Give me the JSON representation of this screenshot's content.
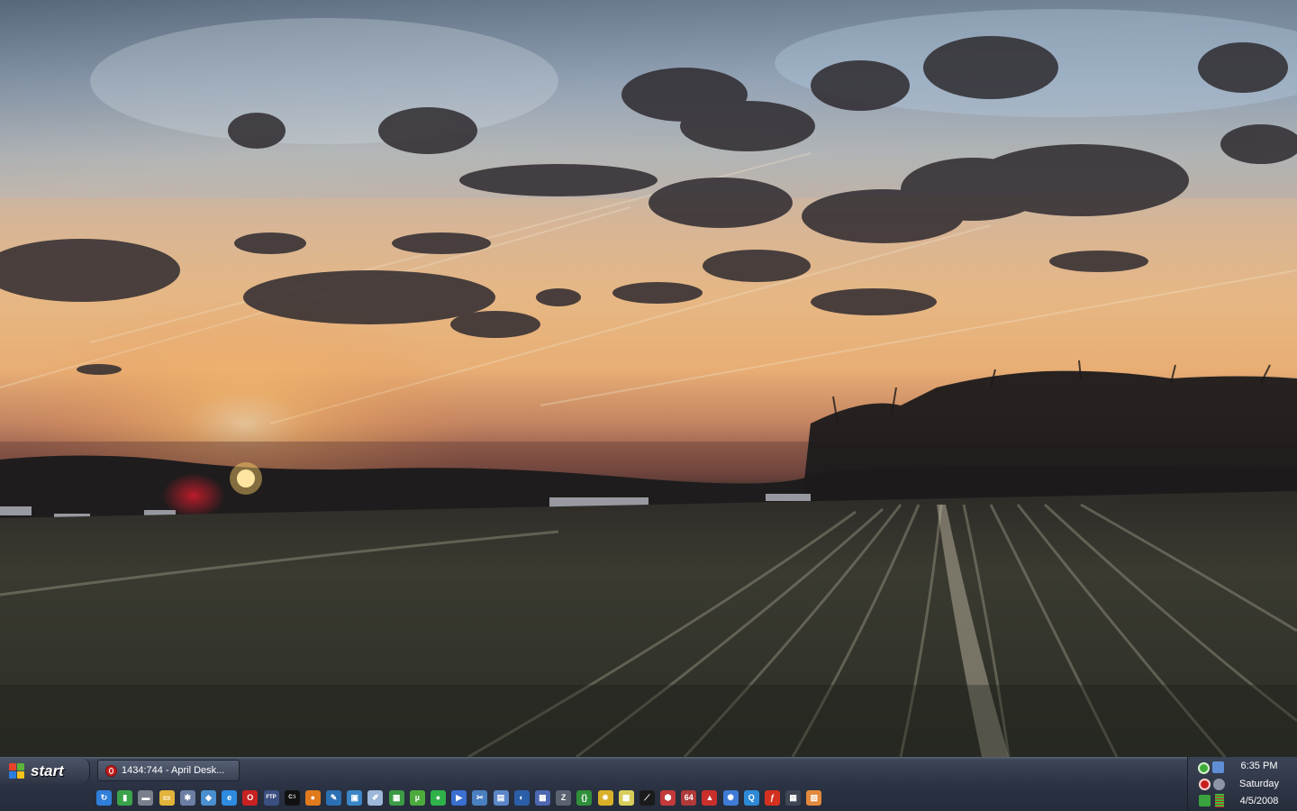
{
  "desktop": {
    "wallpaper": "sunset-over-plowed-field"
  },
  "taskbar": {
    "start_label": "start",
    "tasks": [
      {
        "label": "1434:744 - April Desk...",
        "icon": "opera-icon"
      }
    ],
    "quick_launch": [
      {
        "name": "ql-refresh-icon",
        "glyph": "↻",
        "color": "#2f7fd8"
      },
      {
        "name": "ql-battery-icon",
        "glyph": "▮",
        "color": "#3aa34a"
      },
      {
        "name": "ql-graduation-cap-icon",
        "glyph": "▬",
        "color": "#7a7f8c"
      },
      {
        "name": "ql-folder-icon",
        "glyph": "▭",
        "color": "#e3b43b"
      },
      {
        "name": "ql-settings-gear-icon",
        "glyph": "✱",
        "color": "#6c7fa3"
      },
      {
        "name": "ql-network-icon",
        "glyph": "◆",
        "color": "#4a8fd0"
      },
      {
        "name": "ql-internet-explorer-icon",
        "glyph": "e",
        "color": "#2d8be0"
      },
      {
        "name": "ql-opera-icon",
        "glyph": "O",
        "color": "#c82222"
      },
      {
        "name": "ql-ftp-icon",
        "glyph": "FTP",
        "color": "#3b4f80"
      },
      {
        "name": "ql-command-prompt-icon",
        "glyph": "C:\\",
        "color": "#111111"
      },
      {
        "name": "ql-firefox-icon",
        "glyph": "●",
        "color": "#e07a1c"
      },
      {
        "name": "ql-image-editor-icon",
        "glyph": "✎",
        "color": "#2b6fb4"
      },
      {
        "name": "ql-picture-viewer-icon",
        "glyph": "▣",
        "color": "#3b86c6"
      },
      {
        "name": "ql-notepad-icon",
        "glyph": "✐",
        "color": "#9db7d9"
      },
      {
        "name": "ql-spreadsheet-icon",
        "glyph": "▦",
        "color": "#3c9a45"
      },
      {
        "name": "ql-utorrent-icon",
        "glyph": "µ",
        "color": "#4cab3c"
      },
      {
        "name": "ql-green-dot-icon",
        "glyph": "●",
        "color": "#2fb24a"
      },
      {
        "name": "ql-media-player-icon",
        "glyph": "▶",
        "color": "#3b6fd0"
      },
      {
        "name": "ql-paint-icon",
        "glyph": "✂",
        "color": "#4a7fc0"
      },
      {
        "name": "ql-document-icon",
        "glyph": "▤",
        "color": "#5b87c9"
      },
      {
        "name": "ql-globe-icon",
        "glyph": "◐",
        "color": "#2b5ea8"
      },
      {
        "name": "ql-calculator-icon",
        "glyph": "▦",
        "color": "#4d67b0"
      },
      {
        "name": "ql-zip-icon",
        "glyph": "Z",
        "color": "#5a6270"
      },
      {
        "name": "ql-code-editor-icon",
        "glyph": "{}",
        "color": "#2f8f3a"
      },
      {
        "name": "ql-bug-icon",
        "glyph": "✸",
        "color": "#d9b027"
      },
      {
        "name": "ql-calendar-icon",
        "glyph": "▦",
        "color": "#d8cd5a"
      },
      {
        "name": "ql-vector-app-icon",
        "glyph": "⟋",
        "color": "#1b1b1b"
      },
      {
        "name": "ql-hex-editor-icon",
        "glyph": "⬢",
        "color": "#c23a3a"
      },
      {
        "name": "ql-64-icon",
        "glyph": "64",
        "color": "#b03a3a"
      },
      {
        "name": "ql-rocket-icon",
        "glyph": "▲",
        "color": "#c9302c"
      },
      {
        "name": "ql-cog-app-icon",
        "glyph": "✺",
        "color": "#3f7bd6"
      },
      {
        "name": "ql-search-icon",
        "glyph": "Q",
        "color": "#2e8ad6"
      },
      {
        "name": "ql-flash-icon",
        "glyph": "ƒ",
        "color": "#d4311f"
      },
      {
        "name": "ql-grid-icon",
        "glyph": "▦",
        "color": "#3f4654"
      },
      {
        "name": "ql-gallery-icon",
        "glyph": "▧",
        "color": "#e3893c"
      }
    ]
  },
  "tray": {
    "icons": [
      {
        "name": "tray-utorrent-icon",
        "color": "#3eab3a"
      },
      {
        "name": "tray-network-icon",
        "color": "#5f8ed6"
      },
      {
        "name": "tray-opera-icon",
        "color": "#c71e1e"
      },
      {
        "name": "tray-volume-icon",
        "color": "#8c95a6"
      },
      {
        "name": "tray-update-icon",
        "color": "#3aa33f"
      },
      {
        "name": "tray-meter-icon",
        "color": "#3bbf3b"
      }
    ],
    "clock": {
      "time": "6:35 PM",
      "day": "Saturday",
      "date": "4/5/2008"
    }
  }
}
